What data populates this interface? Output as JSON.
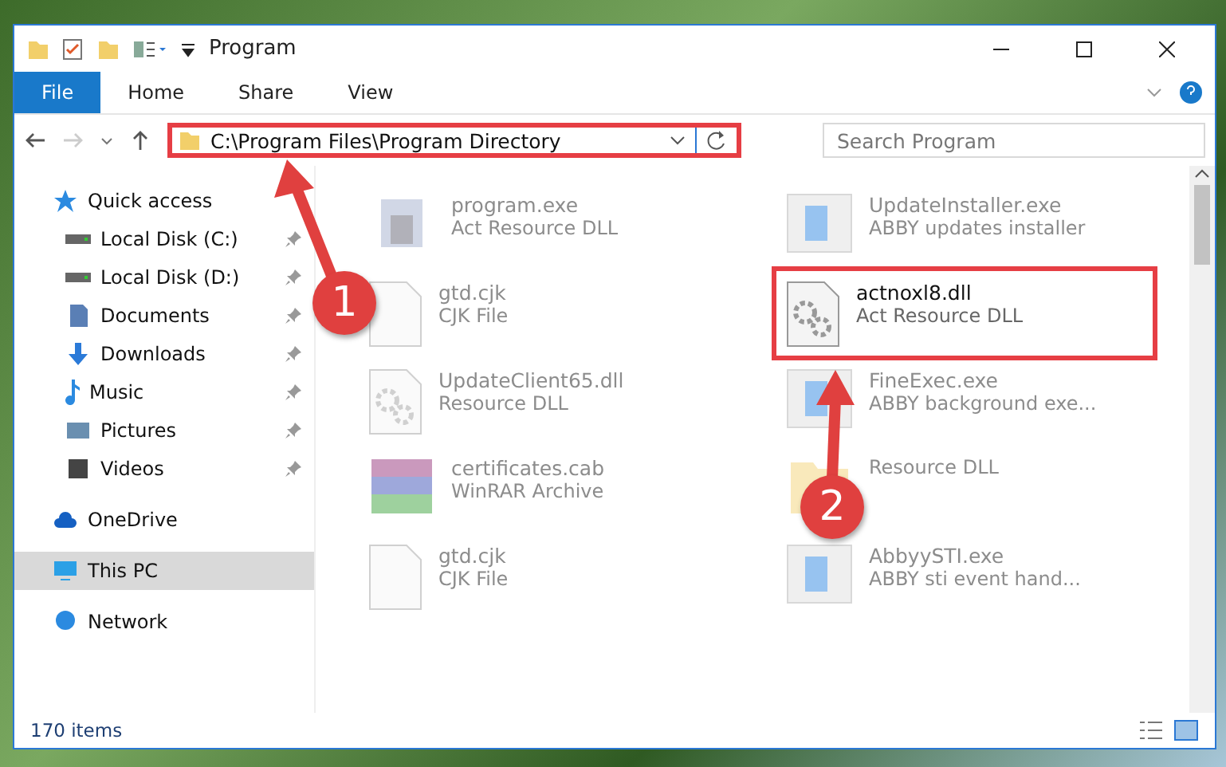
{
  "window": {
    "title": "Program"
  },
  "ribbon": {
    "tabs": [
      {
        "label": "File",
        "selected": true
      },
      {
        "label": "Home",
        "selected": false
      },
      {
        "label": "Share",
        "selected": false
      },
      {
        "label": "View",
        "selected": false
      }
    ]
  },
  "address_bar": {
    "path": "C:\\Program Files\\Program Directory",
    "highlighted": true
  },
  "search": {
    "placeholder": "Search Program"
  },
  "sidebar": {
    "items": [
      {
        "label": "Quick access",
        "selected": false,
        "children": [
          {
            "label": "Local Disk (C:)",
            "pinned": true,
            "selected": false
          },
          {
            "label": "Local Disk (D:)",
            "pinned": true,
            "selected": false
          },
          {
            "label": "Documents",
            "pinned": true,
            "selected": false
          },
          {
            "label": "Downloads",
            "pinned": true,
            "selected": false
          },
          {
            "label": "Music",
            "pinned": true,
            "selected": false
          },
          {
            "label": "Pictures",
            "pinned": true,
            "selected": false
          },
          {
            "label": "Videos",
            "pinned": true,
            "selected": false
          }
        ]
      },
      {
        "label": "OneDrive",
        "selected": false
      },
      {
        "label": "This PC",
        "selected": true
      },
      {
        "label": "Network",
        "selected": false
      }
    ]
  },
  "files": [
    {
      "name": "program.exe",
      "type": "Act Resource DLL",
      "dimmed": true,
      "highlighted": false
    },
    {
      "name": "UpdateInstaller.exe",
      "type": "ABBY updates installer",
      "dimmed": true,
      "highlighted": false
    },
    {
      "name": "gtd.cjk",
      "type": "CJK File",
      "dimmed": true,
      "highlighted": false
    },
    {
      "name": "actnoxl8.dll",
      "type": "Act Resource DLL",
      "dimmed": false,
      "highlighted": true
    },
    {
      "name": "UpdateClient65.dll",
      "type": "Resource DLL",
      "dimmed": true,
      "highlighted": false
    },
    {
      "name": "FineExec.exe",
      "type": "ABBY background exe...",
      "dimmed": true,
      "highlighted": false
    },
    {
      "name": "certificates.cab",
      "type": "WinRAR Archive",
      "dimmed": true,
      "highlighted": false
    },
    {
      "type": "Resource DLL",
      "dimmed": true,
      "highlighted": false
    },
    {
      "name": "gtd.cjk",
      "type": "CJK File",
      "dimmed": true,
      "highlighted": false
    },
    {
      "name": "AbbyySTI.exe",
      "type": "ABBY sti event hand...",
      "dimmed": true,
      "highlighted": false
    }
  ],
  "status_bar": {
    "count": "170 items"
  },
  "annotations": [
    {
      "label": "1"
    },
    {
      "label": "2"
    }
  ]
}
